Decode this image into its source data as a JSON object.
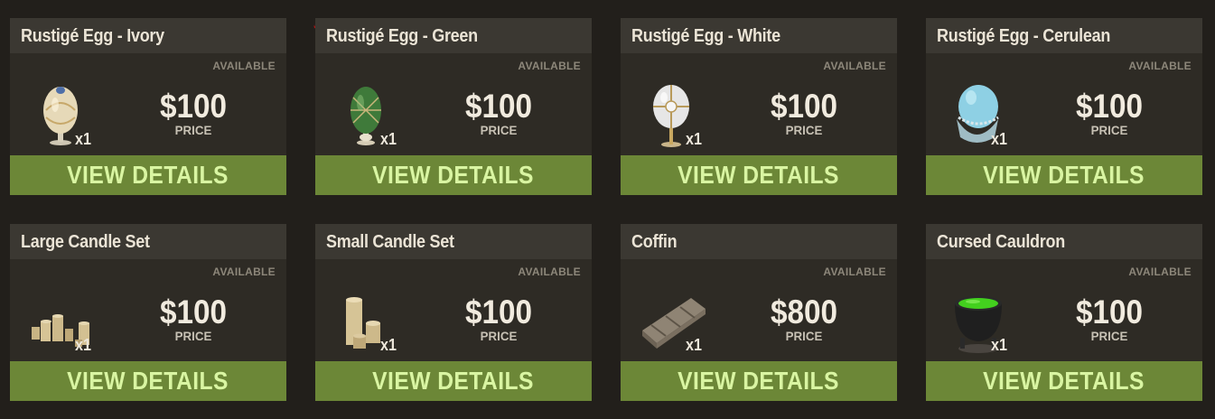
{
  "items": [
    {
      "title": "Rustigé Egg - Ivory",
      "status": "AVAILABLE",
      "price": "$100",
      "price_label": "PRICE",
      "qty": "x1",
      "button": "VIEW DETAILS",
      "icon": "ivory-egg-icon"
    },
    {
      "title": "Rustigé Egg - Green",
      "status": "AVAILABLE",
      "price": "$100",
      "price_label": "PRICE",
      "qty": "x1",
      "button": "VIEW DETAILS",
      "icon": "green-egg-icon"
    },
    {
      "title": "Rustigé Egg - White",
      "status": "AVAILABLE",
      "price": "$100",
      "price_label": "PRICE",
      "qty": "x1",
      "button": "VIEW DETAILS",
      "icon": "white-egg-icon"
    },
    {
      "title": "Rustigé Egg - Cerulean",
      "status": "AVAILABLE",
      "price": "$100",
      "price_label": "PRICE",
      "qty": "x1",
      "button": "VIEW DETAILS",
      "icon": "cerulean-egg-icon"
    },
    {
      "title": "Large Candle Set",
      "status": "AVAILABLE",
      "price": "$100",
      "price_label": "PRICE",
      "qty": "x1",
      "button": "VIEW DETAILS",
      "icon": "large-candle-set-icon"
    },
    {
      "title": "Small Candle Set",
      "status": "AVAILABLE",
      "price": "$100",
      "price_label": "PRICE",
      "qty": "x1",
      "button": "VIEW DETAILS",
      "icon": "small-candle-set-icon"
    },
    {
      "title": "Coffin",
      "status": "AVAILABLE",
      "price": "$800",
      "price_label": "PRICE",
      "qty": "x1",
      "button": "VIEW DETAILS",
      "icon": "coffin-icon"
    },
    {
      "title": "Cursed Cauldron",
      "status": "AVAILABLE",
      "price": "$100",
      "price_label": "PRICE",
      "qty": "x1",
      "button": "VIEW DETAILS",
      "icon": "cauldron-icon"
    }
  ],
  "colors": {
    "page_background": "#221f1b",
    "card_background": "#2e2b25",
    "header_background": "#3b3832",
    "button_background": "#6c8737",
    "button_text": "#d9f5a2",
    "price_text": "#f1ebdf"
  }
}
